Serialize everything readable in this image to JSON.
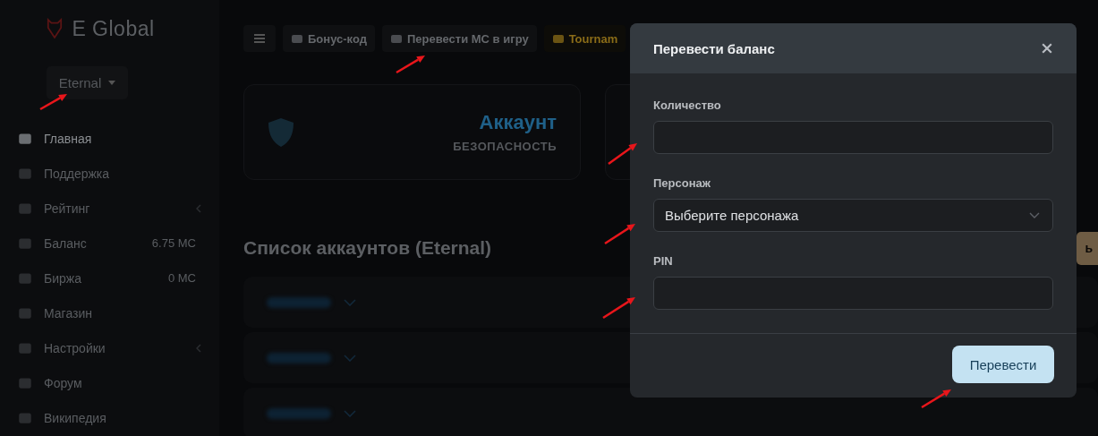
{
  "sidebar": {
    "logo": "E Global",
    "server": "Eternal",
    "items": [
      {
        "label": "Главная",
        "selected": true,
        "submenu": false
      },
      {
        "label": "Поддержка",
        "selected": false,
        "submenu": false
      },
      {
        "label": "Рейтинг",
        "selected": false,
        "submenu": true
      },
      {
        "label": "Баланс",
        "value": "6.75 MC",
        "selected": false,
        "submenu": false
      },
      {
        "label": "Биржа",
        "value": "0 MC",
        "selected": false,
        "submenu": false
      },
      {
        "label": "Магазин",
        "selected": false,
        "submenu": false
      },
      {
        "label": "Настройки",
        "selected": false,
        "submenu": true
      },
      {
        "label": "Форум",
        "selected": false,
        "submenu": false
      },
      {
        "label": "Википедия",
        "selected": false,
        "submenu": false
      }
    ]
  },
  "toolbar": [
    {
      "label": "Бонус-код",
      "kind": "normal"
    },
    {
      "label": "Перевести МС в игру",
      "kind": "normal"
    },
    {
      "label": "Tournam",
      "kind": "highlight"
    }
  ],
  "cards": [
    {
      "title": "Аккаунт",
      "subtitle": "БЕЗОПАСНОСТЬ"
    }
  ],
  "accounts_heading": "Список аккаунтов (Eternal)",
  "side_button": "ь",
  "accounts": [
    {
      "expanded": false
    },
    {
      "expanded": false
    },
    {
      "expanded": false
    }
  ],
  "modal": {
    "title": "Перевести баланс",
    "fields": [
      {
        "label": "Количество",
        "kind": "input"
      },
      {
        "label": "Персонаж",
        "kind": "select",
        "value": "Выберите персонажа"
      },
      {
        "label": "PIN",
        "kind": "input"
      }
    ],
    "submit": "Перевести"
  }
}
